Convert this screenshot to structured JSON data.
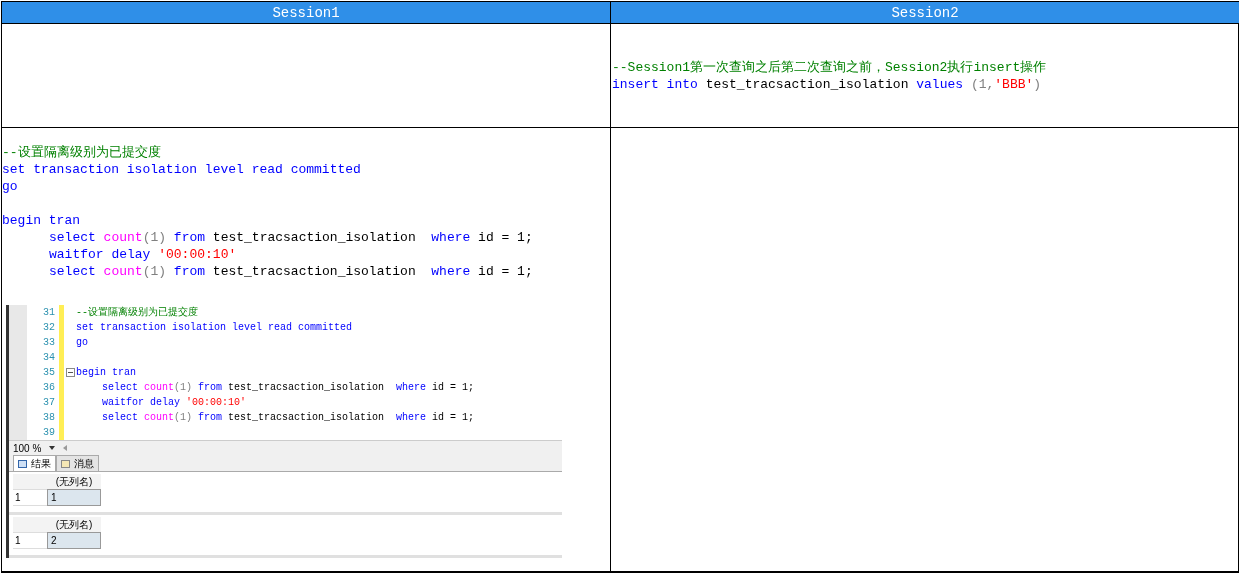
{
  "table": {
    "columns": [
      "Session1",
      "Session2"
    ],
    "rows": [
      {
        "session1": [],
        "session2": [
          {
            "kind": "code",
            "indented": false,
            "tokens": [
              {
                "t": "--Session1第一次查询之后第二次查询之前，Session2执行insert操作",
                "kind": "comment"
              }
            ]
          },
          {
            "kind": "code",
            "indented": false,
            "tokens": [
              {
                "t": "insert",
                "kind": "keyword"
              },
              {
                "t": " into",
                "kind": "keyword"
              },
              {
                "t": " test_tracsaction_isolation",
                "kind": "plain"
              },
              {
                "t": " values",
                "kind": "keyword"
              },
              {
                "t": " (1,",
                "kind": "punct"
              },
              {
                "t": "'BBB'",
                "kind": "string"
              },
              {
                "t": ")",
                "kind": "punct"
              }
            ]
          }
        ]
      },
      {
        "session1": [
          {
            "kind": "code",
            "indented": false,
            "tokens": [
              {
                "t": "--设置隔离级别为已提交度",
                "kind": "comment"
              }
            ]
          },
          {
            "kind": "code",
            "indented": false,
            "tokens": [
              {
                "t": "set transaction isolation level read committed",
                "kind": "keyword"
              }
            ]
          },
          {
            "kind": "code",
            "indented": false,
            "tokens": [
              {
                "t": "go",
                "kind": "keyword"
              }
            ]
          },
          {
            "kind": "blank"
          },
          {
            "kind": "code",
            "indented": false,
            "tokens": [
              {
                "t": "begin tran",
                "kind": "keyword"
              }
            ]
          },
          {
            "kind": "code",
            "indented": true,
            "tokens": [
              {
                "t": "select",
                "kind": "keyword"
              },
              {
                "t": " count",
                "kind": "function"
              },
              {
                "t": "(1)",
                "kind": "punct"
              },
              {
                "t": " from",
                "kind": "keyword"
              },
              {
                "t": " test_tracsaction_isolation ",
                "kind": "plain"
              },
              {
                "t": " where",
                "kind": "keyword"
              },
              {
                "t": " id = 1;",
                "kind": "plain"
              }
            ]
          },
          {
            "kind": "code",
            "indented": true,
            "tokens": [
              {
                "t": "waitfor delay ",
                "kind": "keyword"
              },
              {
                "t": "'00:00:10'",
                "kind": "string"
              }
            ]
          },
          {
            "kind": "code",
            "indented": true,
            "tokens": [
              {
                "t": "select",
                "kind": "keyword"
              },
              {
                "t": " count",
                "kind": "function"
              },
              {
                "t": "(1)",
                "kind": "punct"
              },
              {
                "t": " from",
                "kind": "keyword"
              },
              {
                "t": " test_tracsaction_isolation ",
                "kind": "plain"
              },
              {
                "t": " where",
                "kind": "keyword"
              },
              {
                "t": " id = 1;",
                "kind": "plain"
              }
            ]
          }
        ],
        "session2": [],
        "screenshot": {
          "editor_lines": [
            {
              "number": "31",
              "kind": "code",
              "indented": false,
              "collapsible": false,
              "tokens": [
                {
                  "t": "--设置隔离级别为已提交度",
                  "kind": "comment"
                }
              ]
            },
            {
              "number": "32",
              "kind": "code",
              "indented": false,
              "collapsible": false,
              "tokens": [
                {
                  "t": "set transaction isolation level read committed",
                  "kind": "keyword"
                }
              ]
            },
            {
              "number": "33",
              "kind": "code",
              "indented": false,
              "collapsible": false,
              "tokens": [
                {
                  "t": "go",
                  "kind": "keyword"
                }
              ]
            },
            {
              "number": "34",
              "kind": "blank",
              "collapsible": false
            },
            {
              "number": "35",
              "kind": "code",
              "indented": false,
              "collapsible": true,
              "tokens": [
                {
                  "t": "begin tran",
                  "kind": "keyword"
                }
              ]
            },
            {
              "number": "36",
              "kind": "code",
              "indented": true,
              "collapsible": false,
              "tokens": [
                {
                  "t": "select",
                  "kind": "keyword"
                },
                {
                  "t": " count",
                  "kind": "function"
                },
                {
                  "t": "(1)",
                  "kind": "punct"
                },
                {
                  "t": " from",
                  "kind": "keyword"
                },
                {
                  "t": " test_tracsaction_isolation ",
                  "kind": "plain"
                },
                {
                  "t": " where",
                  "kind": "keyword"
                },
                {
                  "t": " id = 1;",
                  "kind": "plain"
                }
              ]
            },
            {
              "number": "37",
              "kind": "code",
              "indented": true,
              "collapsible": false,
              "tokens": [
                {
                  "t": "waitfor delay ",
                  "kind": "keyword"
                },
                {
                  "t": "'00:00:10'",
                  "kind": "string"
                }
              ]
            },
            {
              "number": "38",
              "kind": "code",
              "indented": true,
              "collapsible": false,
              "tokens": [
                {
                  "t": "select",
                  "kind": "keyword"
                },
                {
                  "t": " count",
                  "kind": "function"
                },
                {
                  "t": "(1)",
                  "kind": "punct"
                },
                {
                  "t": " from",
                  "kind": "keyword"
                },
                {
                  "t": " test_tracsaction_isolation ",
                  "kind": "plain"
                },
                {
                  "t": " where",
                  "kind": "keyword"
                },
                {
                  "t": " id = 1;",
                  "kind": "plain"
                }
              ]
            },
            {
              "number": "39",
              "kind": "blank",
              "collapsible": false
            }
          ],
          "zoom": "100 %",
          "tabs": [
            {
              "label": "结果",
              "selected": true
            },
            {
              "label": "消息",
              "selected": false
            }
          ],
          "results": [
            {
              "column": "(无列名)",
              "row_number": "1",
              "value": "1"
            },
            {
              "column": "(无列名)",
              "row_number": "1",
              "value": "2"
            }
          ]
        }
      }
    ]
  }
}
